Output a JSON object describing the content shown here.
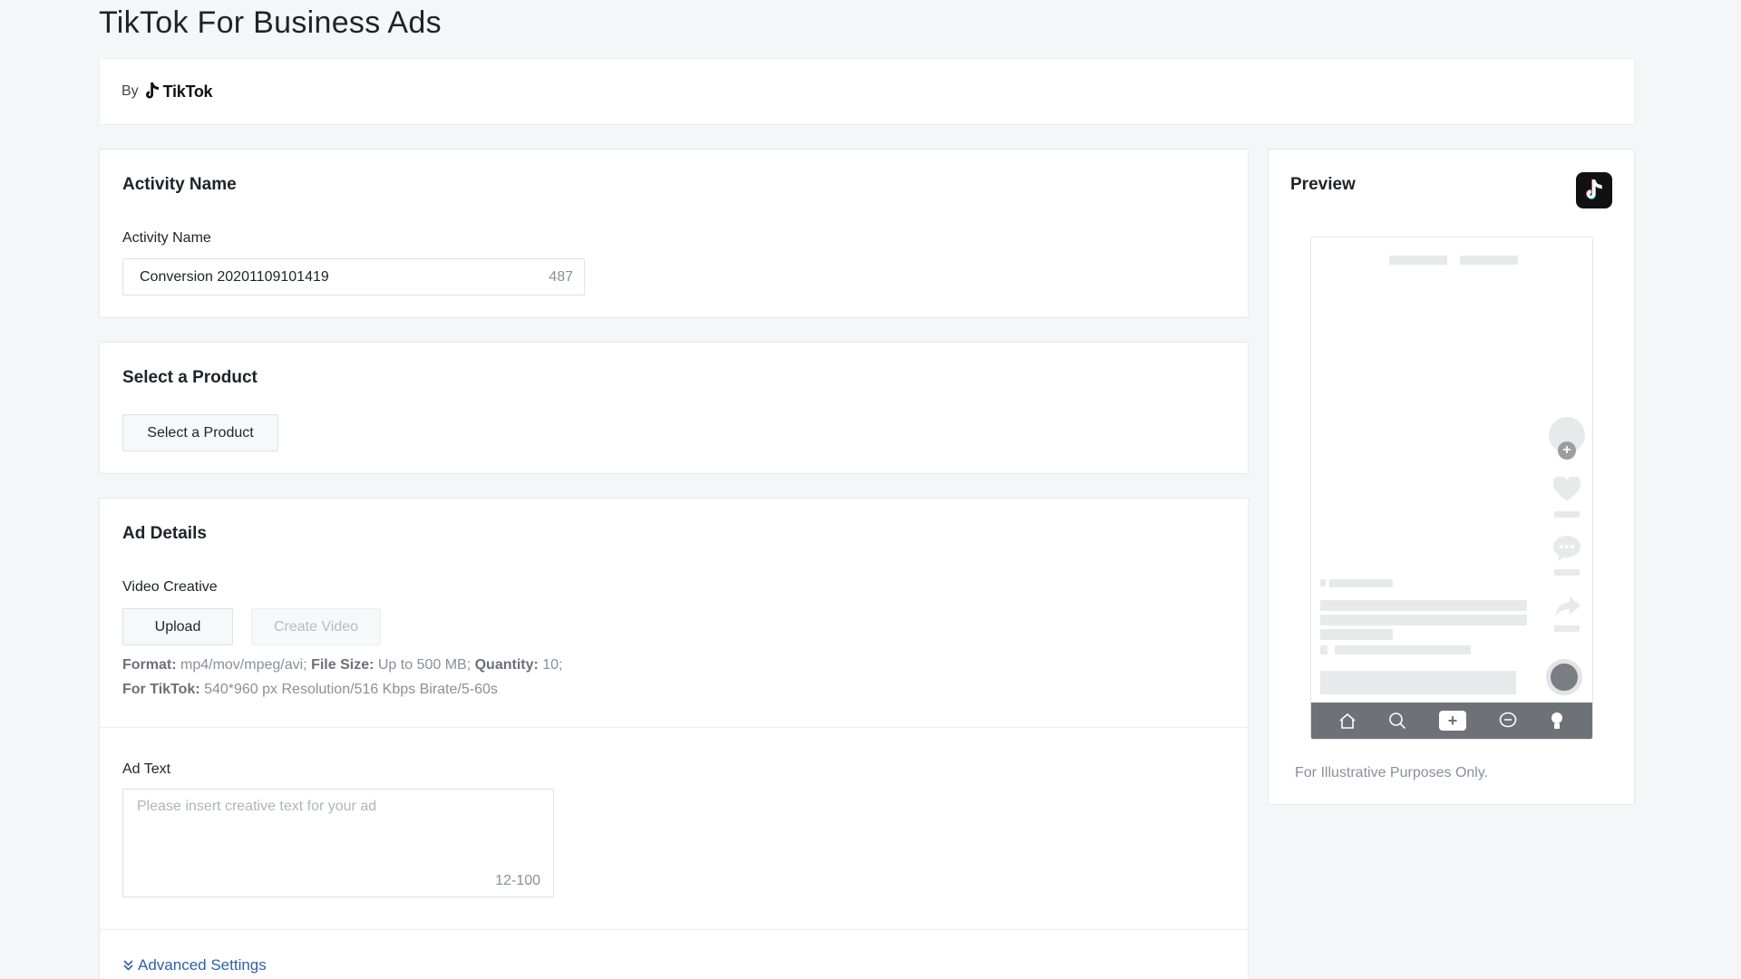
{
  "page": {
    "title": "TikTok For Business Ads"
  },
  "brand": {
    "by_label": "By",
    "logo_text": "TikTok"
  },
  "activity": {
    "section_title": "Activity Name",
    "field_label": "Activity Name",
    "input_value": "Conversion 20201109101419",
    "char_count": "487"
  },
  "product": {
    "section_title": "Select a Product",
    "button_label": "Select a Product"
  },
  "ad_details": {
    "section_title": "Ad Details",
    "video_label": "Video Creative",
    "upload_label": "Upload",
    "create_video_label": "Create Video",
    "spec_format_key": "Format:",
    "spec_format_val": " mp4/mov/mpeg/avi; ",
    "spec_size_key": "File Size:",
    "spec_size_val": " Up to 500 MB; ",
    "spec_qty_key": "Quantity:",
    "spec_qty_val": " 10;",
    "spec_tiktok_key": "For TikTok:",
    "spec_tiktok_val": " 540*960 px Resolution/516 Kbps Birate/5-60s",
    "ad_text_label": "Ad Text",
    "ad_text_placeholder": "Please insert creative text for your ad",
    "ad_text_range": "12-100",
    "advanced_label": "Advanced Settings"
  },
  "preview": {
    "title": "Preview",
    "note": "For Illustrative Purposes Only."
  },
  "colors": {
    "accent_link": "#2f5fa6",
    "background": "#f5f6f7",
    "phone_nav": "#6e7176"
  }
}
